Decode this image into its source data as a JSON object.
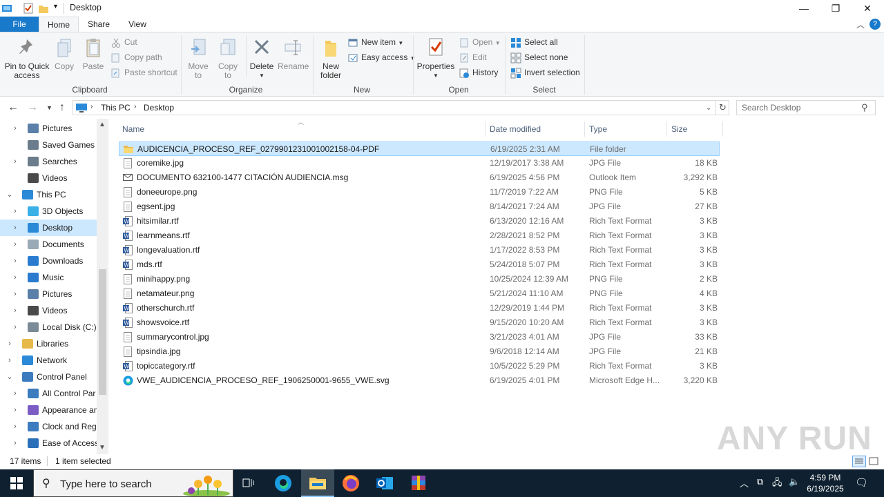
{
  "window": {
    "title": "Desktop",
    "controls": {
      "minimize": "—",
      "maximize": "❐",
      "close": "✕"
    }
  },
  "tabs": [
    "File",
    "Home",
    "Share",
    "View"
  ],
  "ribbon": {
    "clipboard": {
      "label": "Clipboard",
      "pin": "Pin to Quick\naccess",
      "pin_l1": "Pin to Quick",
      "pin_l2": "access",
      "copy": "Copy",
      "paste": "Paste",
      "cut": "Cut",
      "copy_path": "Copy path",
      "paste_shortcut": "Paste shortcut"
    },
    "organize": {
      "label": "Organize",
      "move_l1": "Move",
      "move_l2": "to",
      "copy_l1": "Copy",
      "copy_l2": "to",
      "delete": "Delete",
      "rename": "Rename"
    },
    "new": {
      "label": "New",
      "folder_l1": "New",
      "folder_l2": "folder",
      "new_item": "New item",
      "easy_access": "Easy access"
    },
    "open": {
      "label": "Open",
      "properties": "Properties",
      "open": "Open",
      "edit": "Edit",
      "history": "History"
    },
    "select": {
      "label": "Select",
      "select_all": "Select all",
      "select_none": "Select none",
      "invert": "Invert selection"
    }
  },
  "address": {
    "crumbs": [
      "This PC",
      "Desktop"
    ],
    "search_placeholder": "Search Desktop"
  },
  "nav": [
    {
      "label": "Pictures",
      "indent": 1,
      "expand": ">",
      "color": "#5a7fa8"
    },
    {
      "label": "Saved Games",
      "indent": 1,
      "expand": "",
      "color": "#6b7d8c"
    },
    {
      "label": "Searches",
      "indent": 1,
      "expand": ">",
      "color": "#6b7d8c"
    },
    {
      "label": "Videos",
      "indent": 1,
      "expand": "",
      "color": "#4a4a4a"
    },
    {
      "label": "This PC",
      "indent": 0,
      "expand": "v",
      "color": "#2b8ad8"
    },
    {
      "label": "3D Objects",
      "indent": 1,
      "expand": ">",
      "color": "#39b0e6"
    },
    {
      "label": "Desktop",
      "indent": 1,
      "expand": ">",
      "color": "#2b8ad8",
      "selected": true
    },
    {
      "label": "Documents",
      "indent": 1,
      "expand": ">",
      "color": "#9aa9b6"
    },
    {
      "label": "Downloads",
      "indent": 1,
      "expand": ">",
      "color": "#2a7bd0"
    },
    {
      "label": "Music",
      "indent": 1,
      "expand": ">",
      "color": "#2a7bd0"
    },
    {
      "label": "Pictures",
      "indent": 1,
      "expand": ">",
      "color": "#5a7fa8"
    },
    {
      "label": "Videos",
      "indent": 1,
      "expand": ">",
      "color": "#4a4a4a"
    },
    {
      "label": "Local Disk (C:)",
      "indent": 1,
      "expand": ">",
      "color": "#7a8a96"
    },
    {
      "label": "Libraries",
      "indent": 0,
      "expand": ">",
      "color": "#e7b94a"
    },
    {
      "label": "Network",
      "indent": 0,
      "expand": ">",
      "color": "#2b8ad8"
    },
    {
      "label": "Control Panel",
      "indent": 0,
      "expand": "v",
      "color": "#3c7bbd"
    },
    {
      "label": "All Control Par",
      "indent": 1,
      "expand": ">",
      "color": "#3c7bbd"
    },
    {
      "label": "Appearance an",
      "indent": 1,
      "expand": ">",
      "color": "#7a5cc4"
    },
    {
      "label": "Clock and Regi",
      "indent": 1,
      "expand": ">",
      "color": "#3c7bbd"
    },
    {
      "label": "Ease of Access",
      "indent": 1,
      "expand": ">",
      "color": "#2a6fb8"
    }
  ],
  "columns": {
    "name": "Name",
    "date": "Date modified",
    "type": "Type",
    "size": "Size"
  },
  "files": [
    {
      "name": "AUDICENCIA_PROCESO_REF_0279901231001002158-04-PDF",
      "date": "6/19/2025 2:31 AM",
      "type": "File folder",
      "size": "",
      "icon": "folder",
      "selected": true
    },
    {
      "name": "coremike.jpg",
      "date": "12/19/2017 3:38 AM",
      "type": "JPG File",
      "size": "18 KB",
      "icon": "image"
    },
    {
      "name": "DOCUMENTO 632100-1477 CITACIÓN AUDIENCIA.msg",
      "date": "6/19/2025 4:56 PM",
      "type": "Outlook Item",
      "size": "3,292 KB",
      "icon": "mail"
    },
    {
      "name": "doneeurope.png",
      "date": "11/7/2019 7:22 AM",
      "type": "PNG File",
      "size": "5 KB",
      "icon": "image"
    },
    {
      "name": "egsent.jpg",
      "date": "8/14/2021 7:24 AM",
      "type": "JPG File",
      "size": "27 KB",
      "icon": "image"
    },
    {
      "name": "hitsimilar.rtf",
      "date": "6/13/2020 12:16 AM",
      "type": "Rich Text Format",
      "size": "3 KB",
      "icon": "word"
    },
    {
      "name": "learnmeans.rtf",
      "date": "2/28/2021 8:52 PM",
      "type": "Rich Text Format",
      "size": "3 KB",
      "icon": "word"
    },
    {
      "name": "longevaluation.rtf",
      "date": "1/17/2022 8:53 PM",
      "type": "Rich Text Format",
      "size": "3 KB",
      "icon": "word"
    },
    {
      "name": "mds.rtf",
      "date": "5/24/2018 5:07 PM",
      "type": "Rich Text Format",
      "size": "3 KB",
      "icon": "word"
    },
    {
      "name": "minihappy.png",
      "date": "10/25/2024 12:39 AM",
      "type": "PNG File",
      "size": "2 KB",
      "icon": "image"
    },
    {
      "name": "netamateur.png",
      "date": "5/21/2024 11:10 AM",
      "type": "PNG File",
      "size": "4 KB",
      "icon": "image"
    },
    {
      "name": "otherschurch.rtf",
      "date": "12/29/2019 1:44 PM",
      "type": "Rich Text Format",
      "size": "3 KB",
      "icon": "word"
    },
    {
      "name": "showsvoice.rtf",
      "date": "9/15/2020 10:20 AM",
      "type": "Rich Text Format",
      "size": "3 KB",
      "icon": "word"
    },
    {
      "name": "summarycontrol.jpg",
      "date": "3/21/2023 4:01 AM",
      "type": "JPG File",
      "size": "33 KB",
      "icon": "image"
    },
    {
      "name": "tipsindia.jpg",
      "date": "9/6/2018 12:14 AM",
      "type": "JPG File",
      "size": "21 KB",
      "icon": "image"
    },
    {
      "name": "topiccategory.rtf",
      "date": "10/5/2022 5:29 PM",
      "type": "Rich Text Format",
      "size": "3 KB",
      "icon": "word"
    },
    {
      "name": "VWE_AUDICENCIA_PROCESO_REF_1906250001-9655_VWE.svg",
      "date": "6/19/2025 4:01 PM",
      "type": "Microsoft Edge H...",
      "size": "3,220 KB",
      "icon": "edge"
    }
  ],
  "status": {
    "count": "17 items",
    "selected": "1 item selected"
  },
  "taskbar": {
    "search_placeholder": "Type here to search",
    "time": "4:59 PM",
    "date": "6/19/2025"
  },
  "watermark": "ANY RUN"
}
